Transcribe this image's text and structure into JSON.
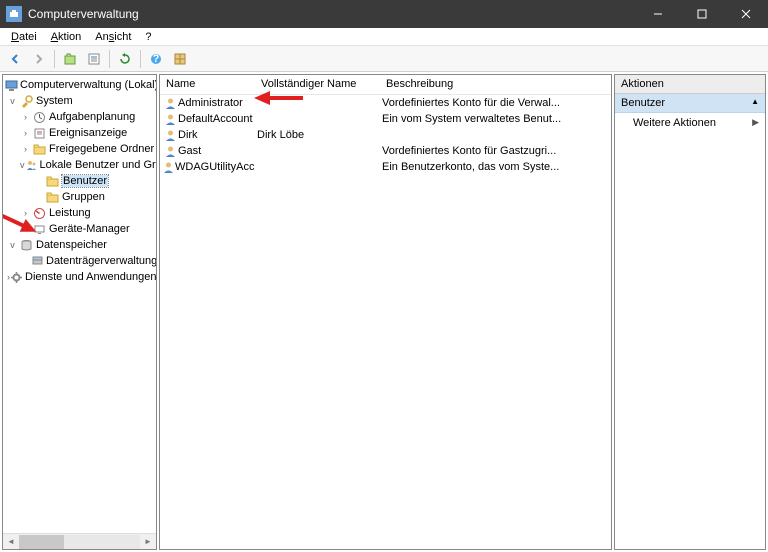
{
  "window": {
    "title": "Computerverwaltung"
  },
  "menu": {
    "datei": "Datei",
    "aktion": "Aktion",
    "ansicht": "Ansicht",
    "help": "?"
  },
  "tree": {
    "root": "Computerverwaltung (Lokal)",
    "system": "System",
    "aufgaben": "Aufgabenplanung",
    "ereignis": "Ereignisanzeige",
    "freigeg": "Freigegebene Ordner",
    "lokale": "Lokale Benutzer und Gruppen",
    "benutzer": "Benutzer",
    "gruppen": "Gruppen",
    "leistung": "Leistung",
    "geraete": "Geräte-Manager",
    "daten": "Datenspeicher",
    "datentraeger": "Datenträgerverwaltung",
    "dienste": "Dienste und Anwendungen"
  },
  "cols": {
    "name": "Name",
    "full": "Vollständiger Name",
    "desc": "Beschreibung"
  },
  "users": [
    {
      "name": "Administrator",
      "full": "",
      "desc": "Vordefiniertes Konto für die Verwal..."
    },
    {
      "name": "DefaultAccount",
      "full": "",
      "desc": "Ein vom System verwaltetes Benut..."
    },
    {
      "name": "Dirk",
      "full": "Dirk Löbe",
      "desc": ""
    },
    {
      "name": "Gast",
      "full": "",
      "desc": "Vordefiniertes Konto für Gastzugri..."
    },
    {
      "name": "WDAGUtilityAccount",
      "full": "",
      "desc": "Ein Benutzerkonto, das vom Syste..."
    }
  ],
  "actions": {
    "header": "Aktionen",
    "category": "Benutzer",
    "more": "Weitere Aktionen"
  }
}
